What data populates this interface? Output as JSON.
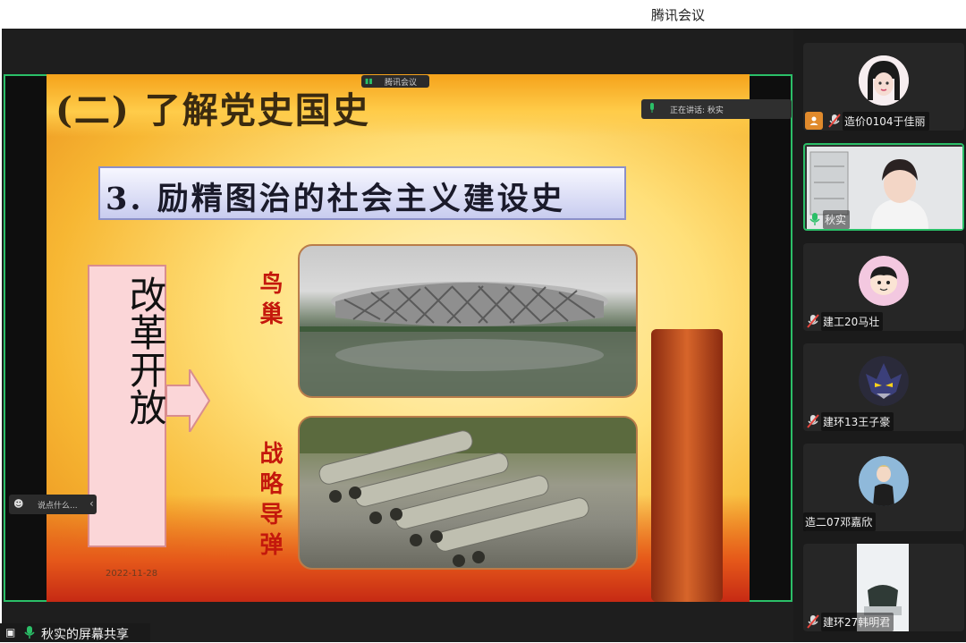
{
  "window": {
    "title": "腾讯会议"
  },
  "meeting": {
    "top_pill_label": "腾讯会议",
    "speaking_label": "正在讲话: 秋实",
    "chat_placeholder": "说点什么...",
    "share_label": "秋实的屏幕共享"
  },
  "slide": {
    "heading": "(二) 了解党史国史",
    "subtitle": "3. 励精图治的社会主义建设史",
    "reform_text": "改革开放",
    "label_bird_nest": "鸟巢",
    "label_missile": "战略导弹",
    "date": "2022-11-28"
  },
  "participants": [
    {
      "name": "造价0104于佳丽",
      "mic": "muted",
      "host": true
    },
    {
      "name": "秋实",
      "mic": "active",
      "host": false,
      "speaking": true
    },
    {
      "name": "建工20马壮",
      "mic": "muted",
      "host": false
    },
    {
      "name": "建环13王子豪",
      "mic": "muted",
      "host": false
    },
    {
      "name": "造二07邓嘉欣",
      "mic": "none",
      "host": false
    },
    {
      "name": "建环27韩明君",
      "mic": "muted",
      "host": false
    }
  ],
  "colors": {
    "accent_green": "#2bbf68",
    "host_orange": "#e08a2c",
    "muted_red": "#e5433b"
  }
}
